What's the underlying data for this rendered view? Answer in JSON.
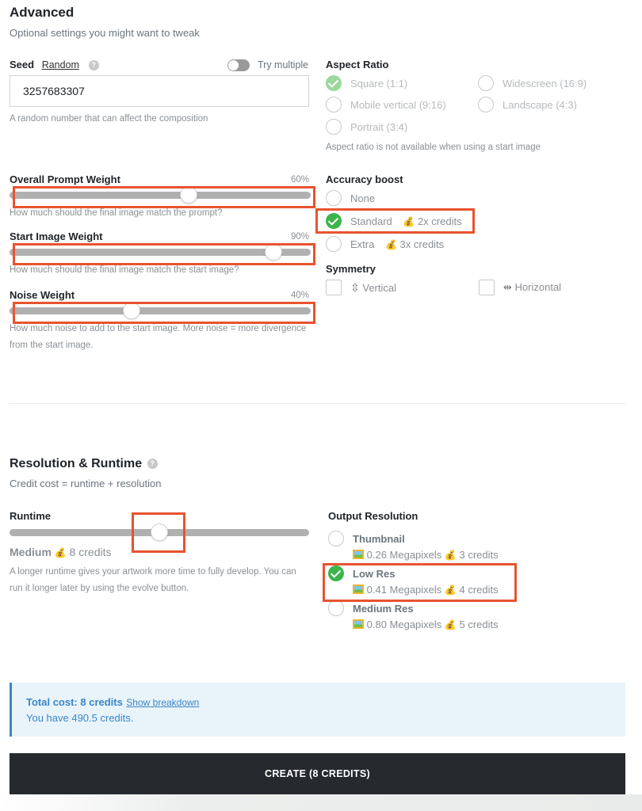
{
  "advanced": {
    "title": "Advanced",
    "subtitle": "Optional settings you might want to tweak"
  },
  "seed": {
    "label": "Seed",
    "random_link": "Random",
    "help_icon": "question-circle-icon",
    "toggle_label": "Try multiple",
    "toggle_on": false,
    "value": "3257683307",
    "help": "A random number that can affect the composition"
  },
  "aspect_ratio": {
    "label": "Aspect Ratio",
    "options": [
      {
        "label": "Square (1:1)",
        "selected": true
      },
      {
        "label": "Widescreen (16:9)",
        "selected": false
      },
      {
        "label": "Mobile vertical (9:16)",
        "selected": false
      },
      {
        "label": "Landscape (4:3)",
        "selected": false
      },
      {
        "label": "Portrait (3:4)",
        "selected": false
      }
    ],
    "note": "Aspect ratio is not available when using a start image"
  },
  "sliders": [
    {
      "label": "Overall Prompt Weight",
      "value_text": "60%",
      "value": 0.6,
      "help": "How much should the final image match the prompt?"
    },
    {
      "label": "Start Image Weight",
      "value_text": "90%",
      "value": 0.9,
      "help": "How much should the final image match the start image?"
    },
    {
      "label": "Noise Weight",
      "value_text": "40%",
      "value": 0.4,
      "help": "How much noise to add to the start image. More noise = more divergence from the start image."
    }
  ],
  "accuracy_boost": {
    "label": "Accuracy boost",
    "options": [
      {
        "label": "None",
        "cost": "",
        "selected": false
      },
      {
        "label": "Standard",
        "cost": "2x credits",
        "selected": true
      },
      {
        "label": "Extra",
        "cost": "3x credits",
        "selected": false
      }
    ]
  },
  "symmetry": {
    "label": "Symmetry",
    "options": [
      {
        "label": "Vertical",
        "icon": "vertical-symmetry-icon",
        "checked": false
      },
      {
        "label": "Horizontal",
        "icon": "horizontal-symmetry-icon",
        "checked": false
      }
    ]
  },
  "resolution_runtime": {
    "title": "Resolution & Runtime",
    "subtitle": "Credit cost = runtime + resolution",
    "runtime": {
      "label": "Runtime",
      "value": 0.5,
      "level": "Medium",
      "cost": "8 credits",
      "help": "A longer runtime gives your artwork more time to fully develop. You can run it longer later by using the evolve button."
    },
    "output_resolution": {
      "label": "Output Resolution",
      "options": [
        {
          "title": "Thumbnail",
          "megapixels": "0.26 Megapixels",
          "cost": "3 credits",
          "selected": false
        },
        {
          "title": "Low Res",
          "megapixels": "0.41 Megapixels",
          "cost": "4 credits",
          "selected": true
        },
        {
          "title": "Medium Res",
          "megapixels": "0.80 Megapixels",
          "cost": "5 credits",
          "selected": false
        }
      ]
    }
  },
  "cost_summary": {
    "total": "Total cost: 8 credits",
    "breakdown_link": "Show breakdown",
    "balance": "You have 490.5 credits."
  },
  "create_button": "CREATE (8 CREDITS)",
  "colors": {
    "accent_blue": "#3a86c8",
    "success_green": "#3bb54a",
    "highlight_red": "#e8532f",
    "button_dark": "#262a2e"
  }
}
